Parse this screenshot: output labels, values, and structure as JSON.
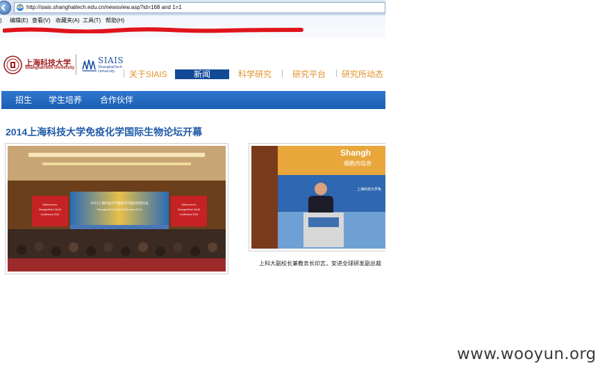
{
  "browser": {
    "url": "http://siais.shanghaitech.edu.cn/newsview.asp?id=168 and 1=1",
    "menu": [
      "编辑(E)",
      "查看(V)",
      "收藏夹(A)",
      "工具(T)",
      "帮助(H)"
    ]
  },
  "site": {
    "logo_cn": "上海科技大学",
    "logo_en": "ShanghaiTech University",
    "siais_title": "SIAIS",
    "siais_sub": [
      "ShanghaiTech",
      "University"
    ],
    "top_nav": [
      {
        "label": "关于SIAIS",
        "active": false
      },
      {
        "label": "新闻",
        "active": true
      },
      {
        "label": "科学研究",
        "active": false
      },
      {
        "label": "研究平台",
        "active": false
      },
      {
        "label": "研究所动态",
        "active": false
      }
    ],
    "sub_nav": [
      "招生",
      "学生培养",
      "合作伙伴"
    ]
  },
  "article": {
    "title": "2014上海科技大学免疫化学国际生物论坛开幕",
    "photo1": {
      "screen_left": "Welcome to ShanghaiTech SIAIS Conference 2014",
      "screen_right": "Welcome to ShanghaiTech SIAIS Conference 2014",
      "banner": "2014上海科技大学免疫化学国际生物论坛 ShanghaiTech SIAIS BioForum 2014"
    },
    "photo2": {
      "backdrop_text": "Shangh",
      "backdrop_sub": "· 细胞内信息",
      "banner": "上海科技大学免"
    },
    "caption": "上科大副校长兼教务长印志，安进全球研发副总裁"
  },
  "watermark": "www.wooyun.org",
  "colors": {
    "brand_red": "#a11d1d",
    "nav_orange": "#e0912a",
    "nav_active": "#124a98",
    "subnav_blue": "#1a5eb3",
    "title_blue": "#1f5aa8"
  }
}
